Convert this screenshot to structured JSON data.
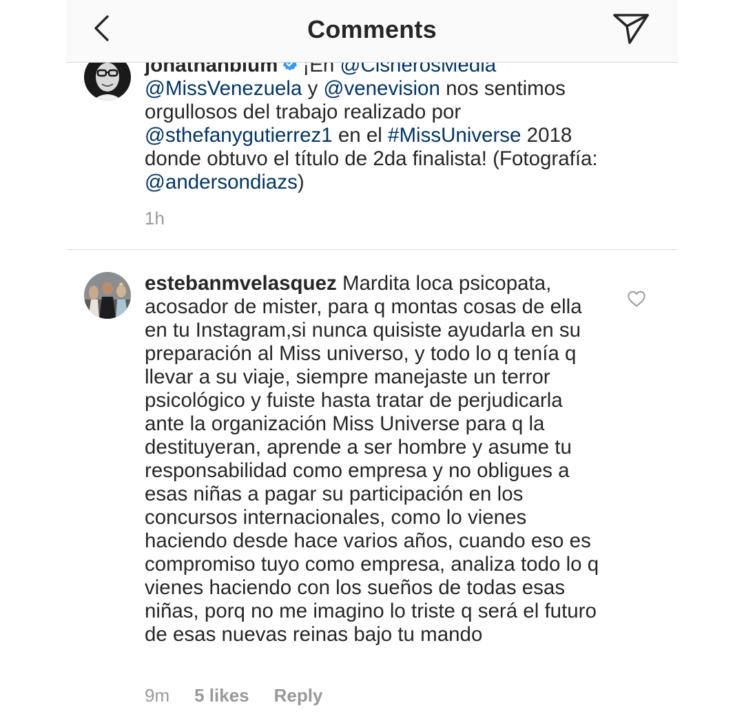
{
  "header": {
    "title": "Comments",
    "back_icon": "chevron-left-icon",
    "share_icon": "paper-plane-icon"
  },
  "comments": [
    {
      "username": "jonathanblum",
      "verified": true,
      "text_parts": [
        {
          "text": "¡En ",
          "type": "plain"
        },
        {
          "text": "@CisnerosMedia",
          "type": "mention"
        },
        {
          "text": " ",
          "type": "plain"
        },
        {
          "text": "@MissVenezuela",
          "type": "mention"
        },
        {
          "text": " y ",
          "type": "plain"
        },
        {
          "text": "@venevision",
          "type": "mention"
        },
        {
          "text": " nos sentimos orgullosos del trabajo realizado por ",
          "type": "plain"
        },
        {
          "text": "@sthefanygutierrez1",
          "type": "mention"
        },
        {
          "text": " en el ",
          "type": "plain"
        },
        {
          "text": "#MissUniverse",
          "type": "mention"
        },
        {
          "text": " 2018 donde obtuvo el título de 2da finalista! (Fotografía: ",
          "type": "plain"
        },
        {
          "text": "@andersondiazs",
          "type": "mention"
        },
        {
          "text": ")",
          "type": "plain"
        }
      ],
      "time": "1h"
    },
    {
      "username": "estebanmvelasquez",
      "verified": false,
      "text": "Mardita loca psicopata, acosador de mister, para q montas cosas de ella en tu Instagram,si nunca quisiste ayudarla en su preparación al Miss universo, y todo lo q tenía q llevar a su viaje, siempre manejaste un terror psicológico y fuiste hasta tratar de perjudicarla ante la organización Miss Universe para q la destituyeran, aprende a ser hombre y asume tu responsabilidad como empresa y no obligues a esas niñas a pagar su participación en los concursos internacionales, como lo vienes haciendo desde hace varios años, cuando eso es compromiso tuyo como empresa, analiza todo lo q vienes haciendo con los sueños de todas esas niñas, porq no me imagino lo triste q será el futuro de esas nuevas reinas bajo tu mando",
      "time": "9m",
      "likes": "5 likes",
      "reply_label": "Reply",
      "like_icon": "heart-outline-icon"
    }
  ],
  "colors": {
    "header_bg": "#fafafa",
    "text": "#262626",
    "mention": "#003569",
    "meta": "#999999",
    "verified": "#3897f0"
  }
}
